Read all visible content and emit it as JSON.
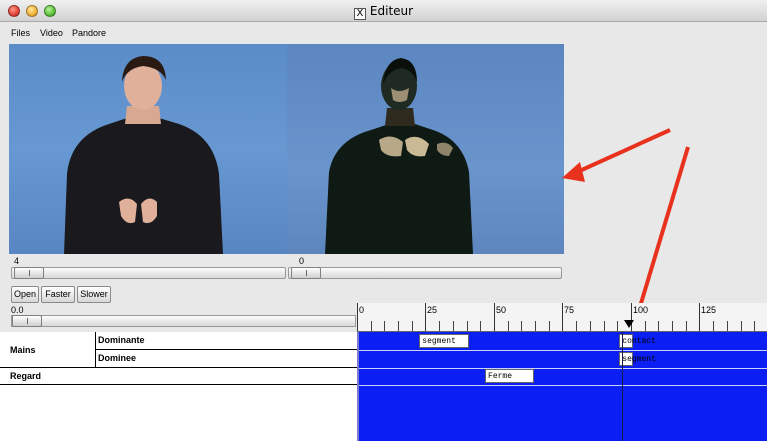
{
  "window": {
    "title": "Editeur",
    "x11_glyph": "X"
  },
  "menu": {
    "items": [
      {
        "label": "Files"
      },
      {
        "label": "Video"
      },
      {
        "label": "Pandore"
      }
    ]
  },
  "players": [
    {
      "frame": "4",
      "position_fraction": 0.0
    },
    {
      "frame": "0",
      "position_fraction": 0.0
    }
  ],
  "controls": {
    "open_label": "Open",
    "faster_label": "Faster",
    "slower_label": "Slower"
  },
  "timeline": {
    "time_value": "0.0",
    "ruler_labels": [
      "0",
      "25",
      "50",
      "75",
      "100",
      "125"
    ],
    "cursor_value": 96,
    "tracks": {
      "group_mains": "Mains",
      "dominante_label": "Dominante",
      "dominee_label": "Dominee",
      "regard_label": "Regard"
    },
    "segments": [
      {
        "track": "dominante",
        "label": "segment",
        "start": 22,
        "end": 40
      },
      {
        "track": "dominante",
        "label": "contact",
        "start": 95,
        "end": 100
      },
      {
        "track": "dominee",
        "label": "segment",
        "start": 95,
        "end": 100
      },
      {
        "track": "regard",
        "label": "Ferme",
        "start": 46,
        "end": 64
      }
    ]
  },
  "colors": {
    "track_background": "#0b1ff2",
    "annotation_arrow": "#e8321e",
    "segment_fill": "#ffffff"
  }
}
